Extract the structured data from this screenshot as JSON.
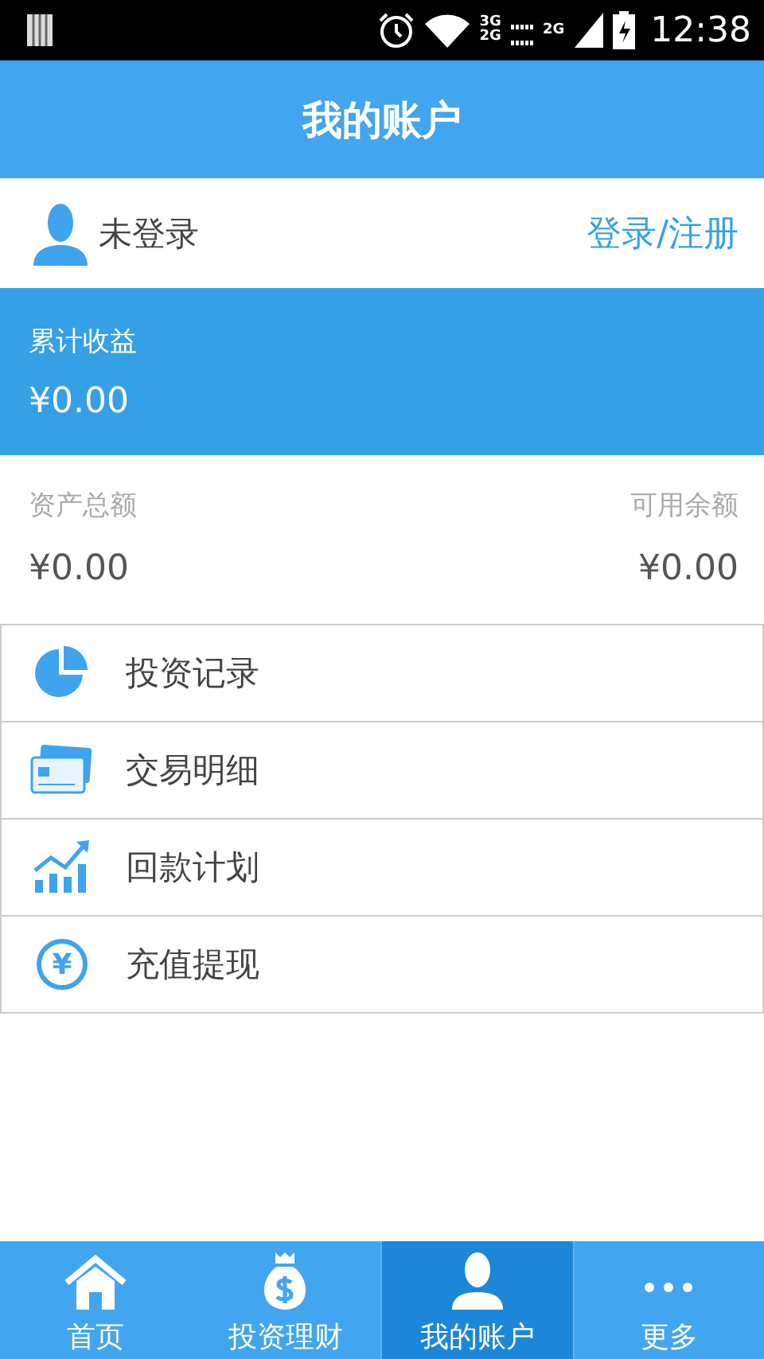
{
  "status_bar": {
    "network_1": "3G",
    "network_2": "2G",
    "network_3": "2G",
    "time": "12:38"
  },
  "header": {
    "title": "我的账户"
  },
  "user": {
    "name": "未登录",
    "login_link": "登录/注册"
  },
  "earnings": {
    "label": "累计收益",
    "value": "¥0.00"
  },
  "assets": [
    {
      "label": "资产总额",
      "value": "¥0.00"
    },
    {
      "label": "可用余额",
      "value": "¥0.00"
    }
  ],
  "menu": [
    {
      "kind": "pie",
      "label": "投资记录"
    },
    {
      "kind": "cards",
      "label": "交易明细"
    },
    {
      "kind": "growth",
      "label": "回款计划"
    },
    {
      "kind": "coin",
      "label": "充值提现",
      "icon_text": "¥"
    }
  ],
  "tabs": [
    {
      "kind": "home",
      "label": "首页",
      "selected": false
    },
    {
      "kind": "bag",
      "label": "投资理财",
      "selected": false
    },
    {
      "kind": "person",
      "label": "我的账户",
      "selected": true
    },
    {
      "kind": "dots",
      "label": "更多",
      "selected": false
    }
  ]
}
